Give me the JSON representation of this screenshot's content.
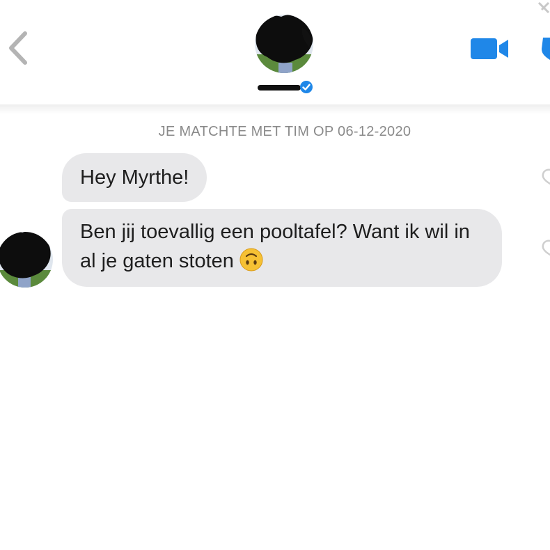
{
  "colors": {
    "accent_blue": "#1f87e8",
    "bubble_bg": "#e8e8ea",
    "system_text": "#8a8a8a",
    "icon_gray": "#b0b0b0"
  },
  "header": {
    "back_icon": "chevron-left-icon",
    "avatar": "profile-avatar-redacted",
    "name": "",
    "verified_icon": "verified-badge-icon",
    "video_icon": "video-camera-icon",
    "safety_icon": "shield-icon"
  },
  "conversation": {
    "match_notice": "JE MATCHTE MET TIM OP 06-12-2020",
    "messages": [
      {
        "sender": "them",
        "text": "Hey Myrthe!"
      },
      {
        "sender": "them",
        "text": "Ben jij toevallig een pooltafel? Want ik wil in al je gaten stoten",
        "emoji": "upside-down-face"
      }
    ],
    "like_icon": "heart-outline-icon"
  }
}
